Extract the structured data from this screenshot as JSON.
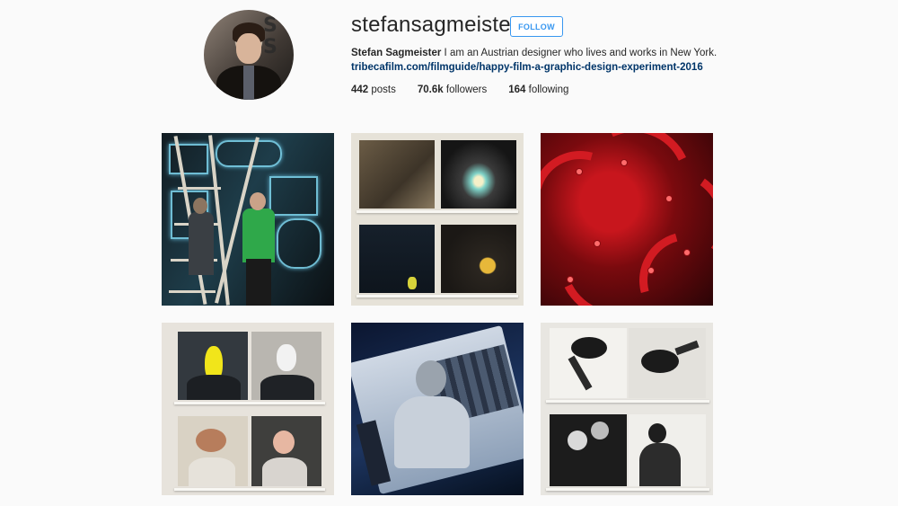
{
  "profile": {
    "username": "stefansagmeister",
    "follow_label": "FOLLOW",
    "full_name": "Stefan Sagmeister",
    "bio_text": " I am an Austrian designer who lives and works in New York.",
    "link": "tribecafilm.com/filmguide/happy-film-a-graphic-design-experiment-2016",
    "stats": {
      "posts_count": "442",
      "posts_label": "posts",
      "followers_count": "70.6k",
      "followers_label": "followers",
      "following_count": "164",
      "following_label": "following"
    }
  },
  "colors": {
    "accent": "#3897f0",
    "link": "#003569",
    "background": "#fafafa"
  }
}
